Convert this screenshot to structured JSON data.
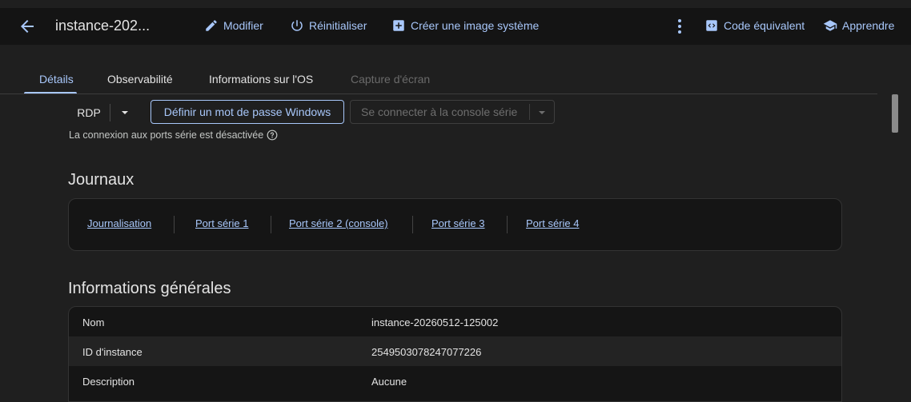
{
  "topbar": {
    "instance_title": "instance-202...",
    "edit_label": "Modifier",
    "reset_label": "Réinitialiser",
    "create_image_label": "Créer une image système",
    "equivalent_code_label": "Code équivalent",
    "learn_label": "Apprendre",
    "accent_color": "#a8c7fa"
  },
  "tabs": [
    {
      "label": "Détails",
      "state": "active"
    },
    {
      "label": "Observabilité",
      "state": "normal"
    },
    {
      "label": "Informations sur l'OS",
      "state": "normal"
    },
    {
      "label": "Capture d'écran",
      "state": "disabled"
    }
  ],
  "connect": {
    "rdp_label": "RDP",
    "set_password_label": "Définir un mot de passe Windows",
    "serial_console_label": "Se connecter à la console série",
    "serial_disabled_msg": "La connexion aux ports série est désactivée"
  },
  "logs": {
    "heading": "Journaux",
    "links": [
      "Journalisation",
      "Port série 1",
      "Port série 2 (console)",
      "Port série 3",
      "Port série 4"
    ]
  },
  "general_info": {
    "heading": "Informations générales",
    "rows": [
      {
        "key": "Nom",
        "value": "instance-20260512-125002"
      },
      {
        "key": "ID d'instance",
        "value": "2549503078247077226"
      },
      {
        "key": "Description",
        "value": "Aucune"
      }
    ]
  }
}
